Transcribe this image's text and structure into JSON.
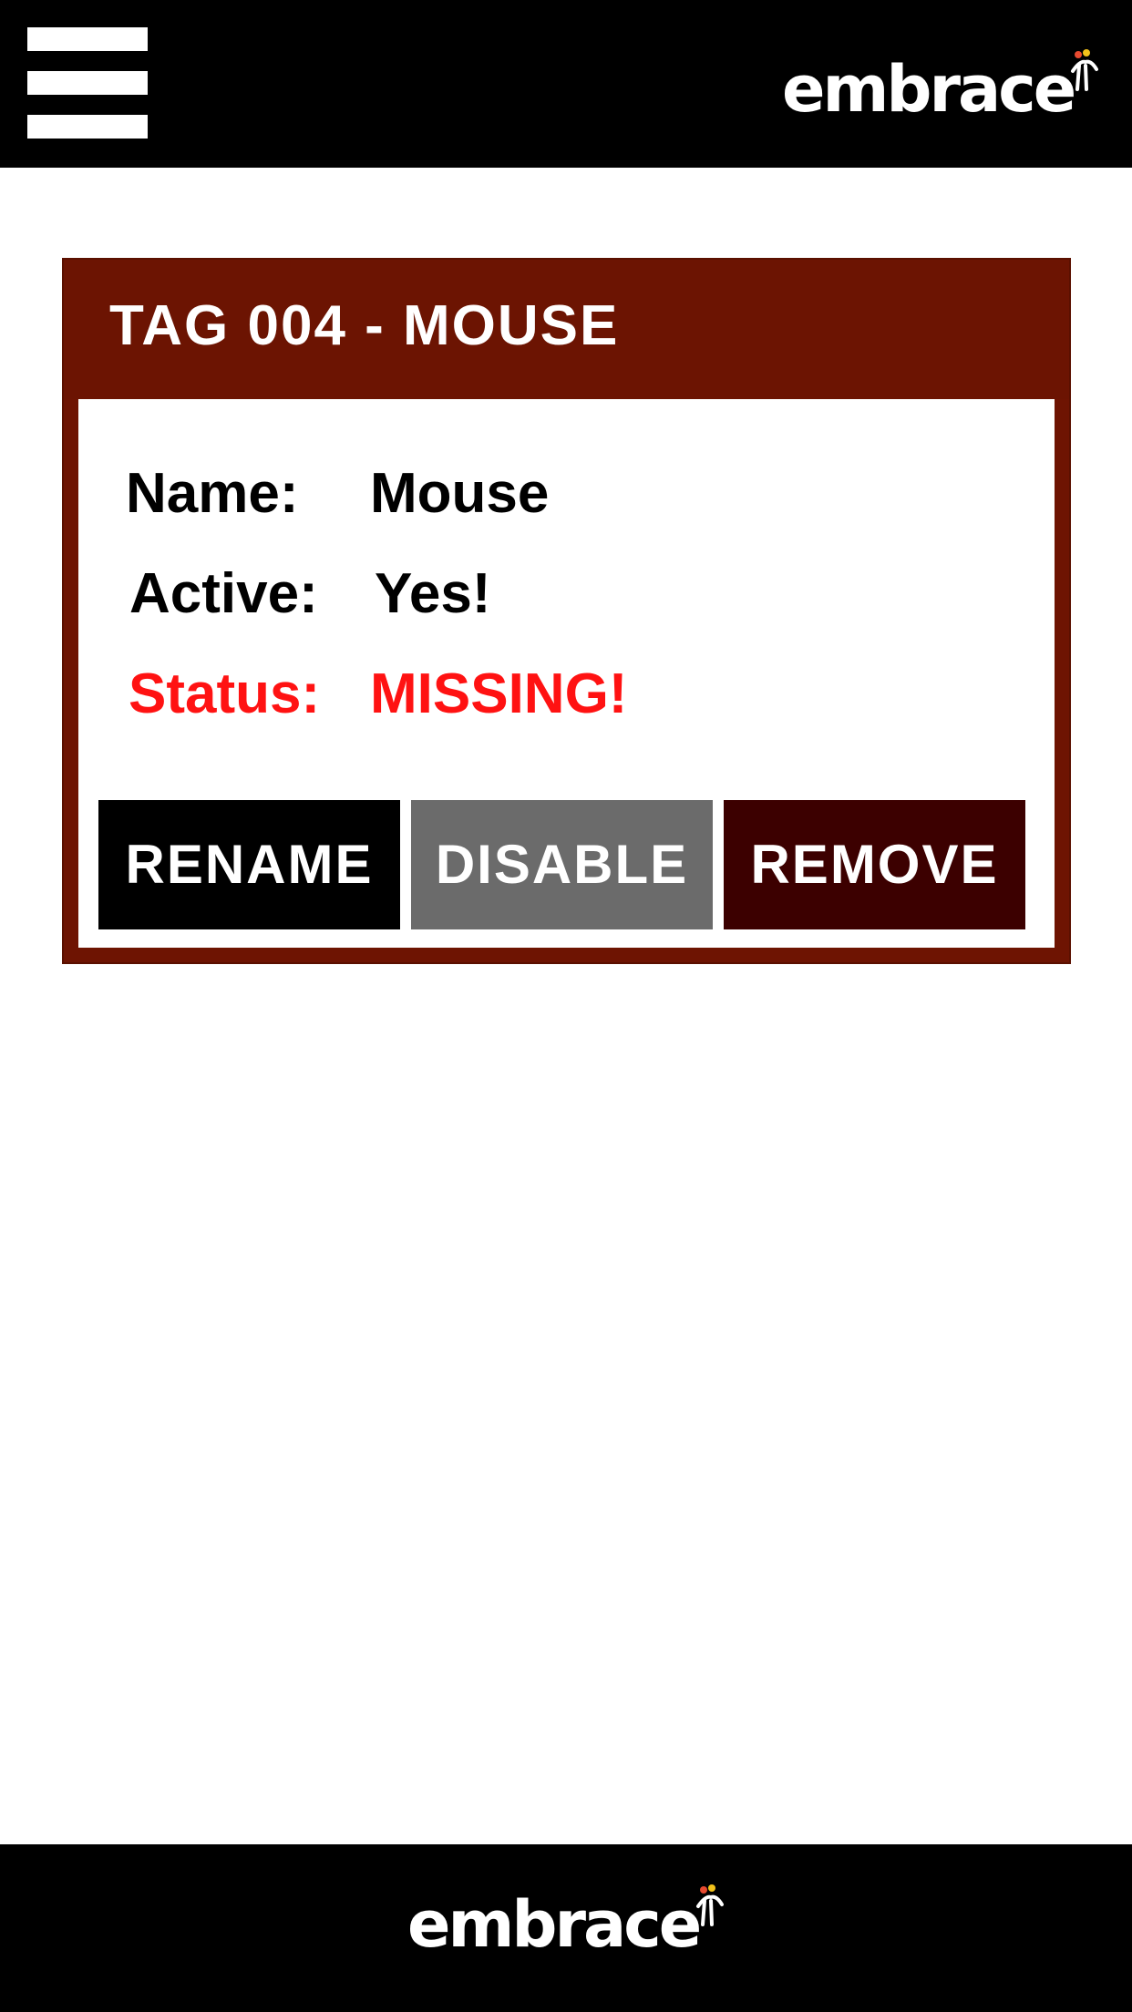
{
  "header": {
    "menu_icon": "hamburger-menu-icon",
    "logo_text": "embrace",
    "background": "#000000"
  },
  "card": {
    "title": "TAG 004 - MOUSE",
    "header_color": "#6c1402",
    "fields": {
      "name_label": "Name:",
      "name_value": "Mouse",
      "active_label": "Active:",
      "active_value": "Yes!",
      "status_label": "Status:",
      "status_value": "MISSING!",
      "status_color": "#ff1212"
    },
    "actions": {
      "rename_label": "RENAME",
      "disable_label": "DISABLE",
      "remove_label": "REMOVE",
      "rename_color": "#000000",
      "disable_color": "#6b6b6b",
      "remove_color": "#3c0000"
    }
  },
  "footer": {
    "logo_text": "embrace",
    "background": "#000000"
  }
}
